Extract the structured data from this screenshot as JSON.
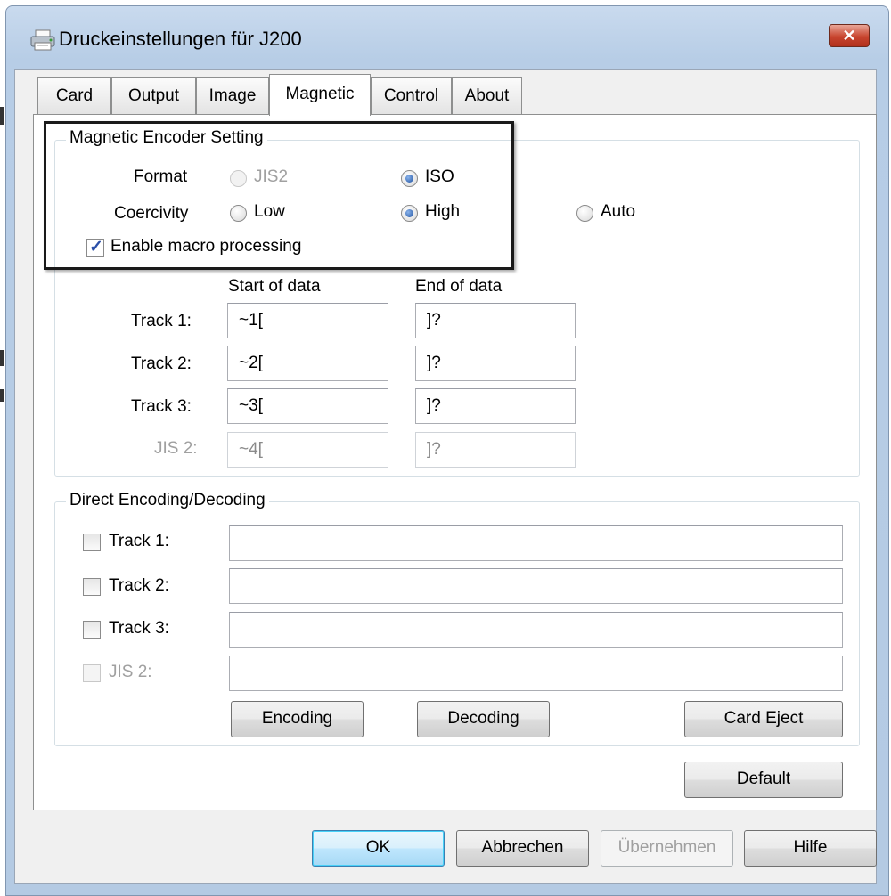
{
  "window": {
    "title": "Druckeinstellungen für J200",
    "close_label": "✕"
  },
  "tabs": [
    "Card",
    "Output",
    "Image",
    "Magnetic",
    "Control",
    "About"
  ],
  "active_tab": "Magnetic",
  "encoder_group": {
    "legend": "Magnetic Encoder Setting",
    "format_label": "Format",
    "format_options": [
      "JIS2",
      "ISO"
    ],
    "format_selected": "ISO",
    "coercivity_label": "Coercivity",
    "coercivity_options": [
      "Low",
      "High",
      "Auto"
    ],
    "coercivity_selected": "High",
    "macro_label": "Enable macro processing",
    "macro_checked": true,
    "start_header": "Start of data",
    "end_header": "End of data",
    "tracks": [
      {
        "label": "Track 1:",
        "start": "~1[",
        "end": "]?"
      },
      {
        "label": "Track 2:",
        "start": "~2[",
        "end": "]?"
      },
      {
        "label": "Track 3:",
        "start": "~3[",
        "end": "]?"
      },
      {
        "label": "JIS 2:",
        "start": "~4[",
        "end": "]?"
      }
    ]
  },
  "direct_group": {
    "legend": "Direct Encoding/Decoding",
    "tracks": [
      {
        "label": "Track 1:",
        "value": ""
      },
      {
        "label": "Track 2:",
        "value": ""
      },
      {
        "label": "Track 3:",
        "value": ""
      },
      {
        "label": "JIS 2:",
        "value": ""
      }
    ],
    "encoding_button": "Encoding",
    "decoding_button": "Decoding",
    "card_eject_button": "Card Eject"
  },
  "default_button": "Default",
  "footer": {
    "ok": "OK",
    "cancel": "Abbrechen",
    "apply": "Übernehmen",
    "help": "Hilfe"
  }
}
